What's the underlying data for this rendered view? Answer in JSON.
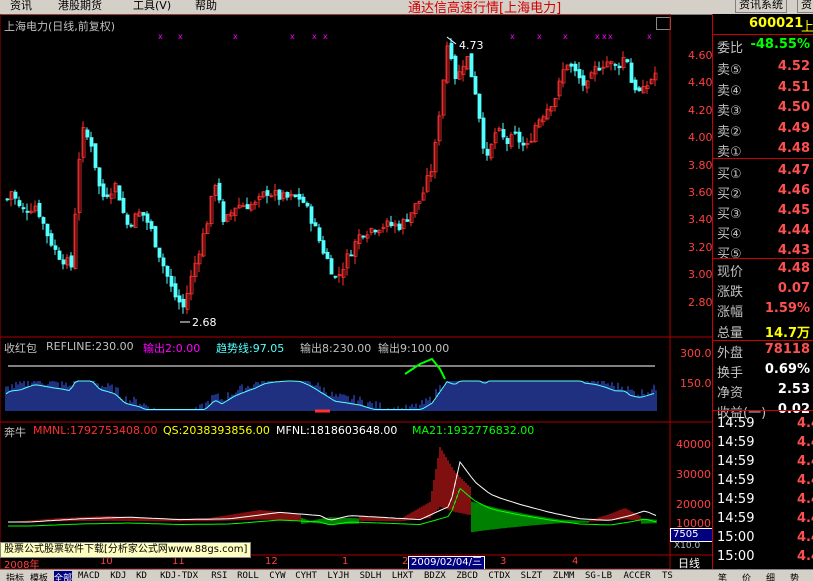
{
  "menu": {
    "items": [
      "资讯",
      "港股期货",
      "工具(V)",
      "帮助"
    ],
    "center_title": "通达信高速行情[上海电力]",
    "right_button_1": "资讯系统",
    "right_button_2": "资"
  },
  "main_chart": {
    "title": "上海电力(日线,前复权)",
    "high_label": "4.73",
    "low_label": "2.68",
    "y_ticks": [
      "4.60",
      "4.40",
      "4.20",
      "4.00",
      "3.80",
      "3.60",
      "3.40",
      "3.20",
      "3.00",
      "2.80"
    ]
  },
  "indicator1": {
    "name": "收红包",
    "refline_label": "REFLINE:230.00",
    "out2_label": "输出2:0.00",
    "trend_label": "趋势线:97.05",
    "out8_label": "输出8:230.00",
    "out9_label": "输出9:100.00",
    "y_ticks": [
      "300.0",
      "150.0"
    ]
  },
  "indicator2": {
    "name": "奔牛",
    "mmnl_label": "MMNL:1792753408.00",
    "qs_label": "QS:2038393856.00",
    "mfnl_label": "MFNL:1818603648.00",
    "ma21_label": "MA21:1932776832.00",
    "y_ticks": [
      "40000",
      "30000",
      "20000",
      "10000"
    ],
    "current_value": "7505",
    "unit_label": "X10.0"
  },
  "time_axis": {
    "year_label": "2008年",
    "months": [
      "10",
      "11",
      "12",
      "1",
      "2",
      "3",
      "4"
    ],
    "cursor_date": "2009/02/04/三"
  },
  "ad_text": "股票公式股票软件下载[分析家公式网www.88gs.com]",
  "quote": {
    "code": "600021",
    "code_suffix": "上",
    "weibi_label": "委比",
    "weibi_value": "-48.55%",
    "sells": [
      {
        "label": "卖⑤",
        "price": "4.52"
      },
      {
        "label": "卖④",
        "price": "4.51"
      },
      {
        "label": "卖③",
        "price": "4.50"
      },
      {
        "label": "卖②",
        "price": "4.49"
      },
      {
        "label": "卖①",
        "price": "4.48"
      }
    ],
    "buys": [
      {
        "label": "买①",
        "price": "4.47"
      },
      {
        "label": "买②",
        "price": "4.46"
      },
      {
        "label": "买③",
        "price": "4.45"
      },
      {
        "label": "买④",
        "price": "4.44"
      },
      {
        "label": "买⑤",
        "price": "4.43"
      }
    ],
    "stats": [
      {
        "label": "现价",
        "value": "4.48",
        "color": "#ff5050"
      },
      {
        "label": "涨跌",
        "value": "0.07",
        "color": "#ff5050"
      },
      {
        "label": "涨幅",
        "value": "1.59%",
        "color": "#ff5050"
      },
      {
        "label": "总量",
        "value": "14.7万",
        "color": "#ffff00"
      },
      {
        "label": "外盘",
        "value": "78118",
        "color": "#ff5050"
      },
      {
        "label": "换手",
        "value": "0.69%",
        "color": "#ffffff"
      },
      {
        "label": "净资",
        "value": "2.53",
        "color": "#ffffff"
      },
      {
        "label": "收益(一)",
        "value": "0.02",
        "color": "#ffffff"
      }
    ],
    "ticks": [
      {
        "time": "14:59",
        "price": "4.4"
      },
      {
        "time": "14:59",
        "price": "4.4"
      },
      {
        "time": "14:59",
        "price": "4.4"
      },
      {
        "time": "14:59",
        "price": "4.4"
      },
      {
        "time": "14:59",
        "price": "4.4"
      },
      {
        "time": "14:59",
        "price": "4.4"
      },
      {
        "time": "15:00",
        "price": "4.4"
      },
      {
        "time": "15:00",
        "price": "4.4"
      }
    ]
  },
  "bottom_tabs": [
    "指标",
    "模板",
    "全部",
    "MACD",
    "KDJ",
    "KD",
    "KDJ-TDX",
    "RSI",
    "ROLL",
    "CYW",
    "CYHT",
    "LYJH",
    "SDLH",
    "LHXT",
    "BDZX",
    "ZBCD",
    "CTDX",
    "SLZT",
    "ZLMM",
    "SG-LB",
    "ACCER",
    "TS"
  ],
  "period_label": "日线",
  "quote_tabs": [
    "笔",
    "价",
    "细",
    "势"
  ],
  "colors": {
    "up": "#ff3030",
    "down": "#54ffff",
    "accent_red": "#ff0000",
    "volume_green": "#00ff00",
    "trend_magenta": "#ff00ff"
  }
}
